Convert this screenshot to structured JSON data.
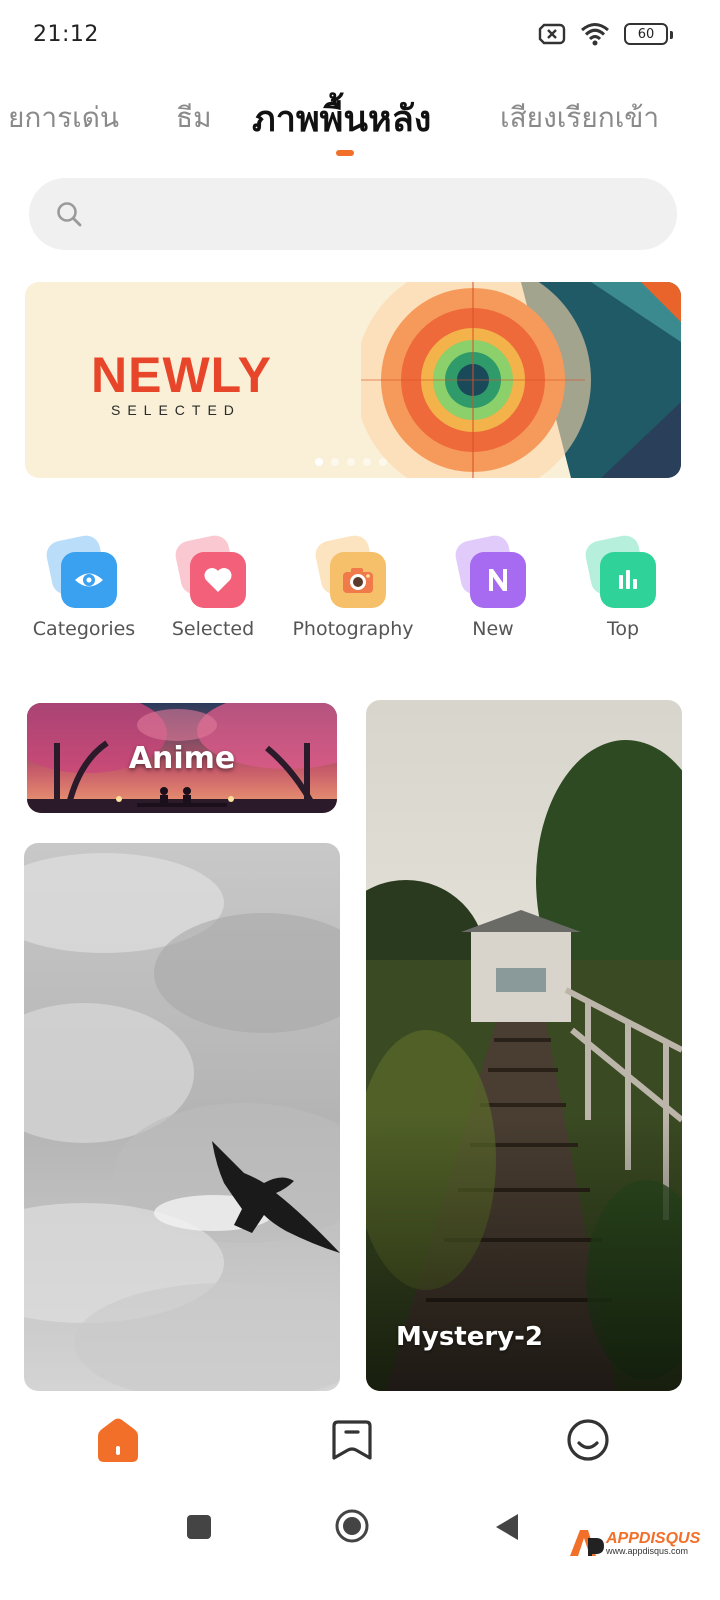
{
  "status_bar": {
    "time": "21:12",
    "battery": "60",
    "icons": [
      "sim-off-icon",
      "wifi-icon",
      "battery-icon"
    ]
  },
  "tabs": [
    {
      "label": "รายการเด่น",
      "visible_text": "ยการเด่น",
      "active": false
    },
    {
      "label": "ธีม",
      "active": false
    },
    {
      "label": "ภาพพื้นหลัง",
      "active": true
    },
    {
      "label": "เสียงเรียกเข้า",
      "active": false
    }
  ],
  "search": {
    "placeholder": "",
    "icon": "search-icon"
  },
  "banner": {
    "title": "NEWLY",
    "subtitle": "SELECTED",
    "slide_count": 5,
    "active_slide": 1
  },
  "categories": [
    {
      "label": "Categories",
      "icon": "eye-icon",
      "color": "#3aa0f0"
    },
    {
      "label": "Selected",
      "icon": "heart-icon",
      "color": "#f2607a"
    },
    {
      "label": "Photography",
      "icon": "camera-icon",
      "color": "#f6b24c"
    },
    {
      "label": "New",
      "icon": "new-n-icon",
      "color": "#a66bf0"
    },
    {
      "label": "Top",
      "icon": "bar-chart-icon",
      "color": "#2fd39a"
    }
  ],
  "wallpapers": {
    "anime": {
      "label": "Anime"
    },
    "sky": {
      "label": ""
    },
    "stairs": {
      "label": "Mystery-2"
    }
  },
  "bottom_nav": [
    {
      "name": "home",
      "icon": "home-icon",
      "active": true
    },
    {
      "name": "collection",
      "icon": "bookmark-icon",
      "active": false
    },
    {
      "name": "profile",
      "icon": "smiley-icon",
      "active": false
    }
  ],
  "system_nav": {
    "buttons": [
      "recents-button",
      "home-button",
      "back-button"
    ]
  },
  "watermark": {
    "text": "APPDISQUS",
    "url": "www.appdisqus.com"
  },
  "colors": {
    "accent": "#f26f2a",
    "search_bg": "#f0f0f0",
    "banner_bg": "#faf0d8"
  }
}
